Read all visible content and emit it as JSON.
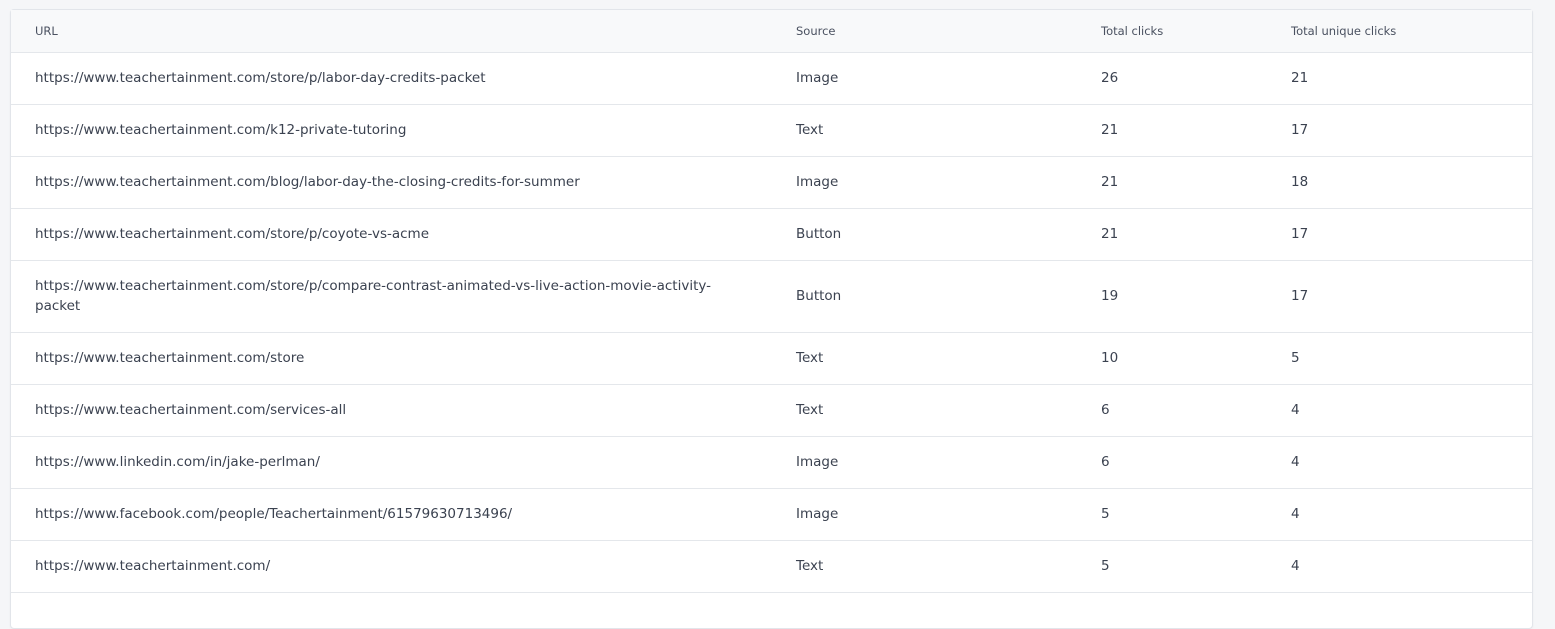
{
  "table": {
    "headers": {
      "url": "URL",
      "source": "Source",
      "total_clicks": "Total clicks",
      "total_unique_clicks": "Total unique clicks"
    },
    "rows": [
      {
        "url": "https://www.teachertainment.com/store/p/labor-day-credits-packet",
        "source": "Image",
        "total_clicks": "26",
        "total_unique_clicks": "21"
      },
      {
        "url": "https://www.teachertainment.com/k12-private-tutoring",
        "source": "Text",
        "total_clicks": "21",
        "total_unique_clicks": "17"
      },
      {
        "url": "https://www.teachertainment.com/blog/labor-day-the-closing-credits-for-summer",
        "source": "Image",
        "total_clicks": "21",
        "total_unique_clicks": "18"
      },
      {
        "url": "https://www.teachertainment.com/store/p/coyote-vs-acme",
        "source": "Button",
        "total_clicks": "21",
        "total_unique_clicks": "17"
      },
      {
        "url": "https://www.teachertainment.com/store/p/compare-contrast-animated-vs-live-action-movie-activity-packet",
        "source": "Button",
        "total_clicks": "19",
        "total_unique_clicks": "17"
      },
      {
        "url": "https://www.teachertainment.com/store",
        "source": "Text",
        "total_clicks": "10",
        "total_unique_clicks": "5"
      },
      {
        "url": "https://www.teachertainment.com/services-all",
        "source": "Text",
        "total_clicks": "6",
        "total_unique_clicks": "4"
      },
      {
        "url": "https://www.linkedin.com/in/jake-perlman/",
        "source": "Image",
        "total_clicks": "6",
        "total_unique_clicks": "4"
      },
      {
        "url": "https://www.facebook.com/people/Teachertainment/61579630713496/",
        "source": "Image",
        "total_clicks": "5",
        "total_unique_clicks": "4"
      },
      {
        "url": "https://www.teachertainment.com/",
        "source": "Text",
        "total_clicks": "5",
        "total_unique_clicks": "4"
      }
    ]
  }
}
